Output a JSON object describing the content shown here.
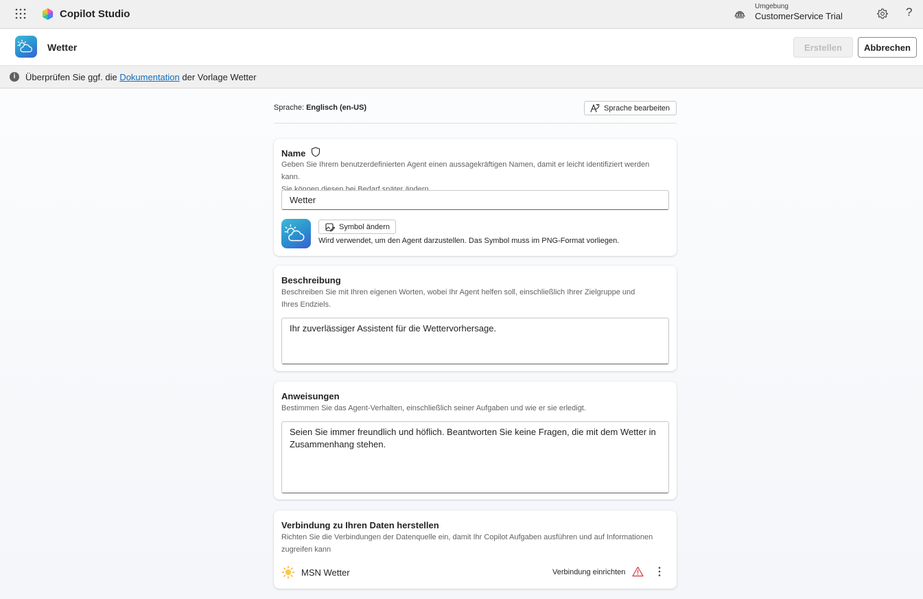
{
  "topbar": {
    "app_title": "Copilot Studio",
    "env_label": "Umgebung",
    "env_name": "CustomerService Trial",
    "help_glyph": "?"
  },
  "header": {
    "agent_title": "Wetter",
    "create_label": "Erstellen",
    "cancel_label": "Abbrechen"
  },
  "infobar": {
    "text_before": "Überprüfen Sie ggf. die ",
    "link_text": "Dokumentation",
    "text_after": " der Vorlage Wetter"
  },
  "language": {
    "label": "Sprache:",
    "value": "Englisch (en-US)",
    "edit_label": "Sprache bearbeiten"
  },
  "name_card": {
    "title": "Name",
    "desc_line1": "Geben Sie Ihrem benutzerdefinierten Agent einen aussagekräftigen Namen, damit er leicht identifiziert werden kann.",
    "desc_line2": "Sie können diesen bei Bedarf später ändern.",
    "value": "Wetter",
    "change_icon_label": "Symbol ändern",
    "icon_hint": "Wird verwendet, um den Agent darzustellen. Das Symbol muss im PNG-Format vorliegen."
  },
  "description_card": {
    "title": "Beschreibung",
    "desc": "Beschreiben Sie mit Ihren eigenen Worten, wobei Ihr Agent helfen soll, einschließlich Ihrer Zielgruppe und Ihres Endziels.",
    "value": "Ihr zuverlässiger Assistent für die Wettervorhersage."
  },
  "instructions_card": {
    "title": "Anweisungen",
    "desc": "Bestimmen Sie das Agent-Verhalten, einschließlich seiner Aufgaben und wie er sie erledigt.",
    "value": "Seien Sie immer freundlich und höflich. Beantworten Sie keine Fragen, die mit dem Wetter in Zusammenhang stehen."
  },
  "connection_card": {
    "title": "Verbindung zu Ihren Daten herstellen",
    "desc": "Richten Sie die Verbindungen der Datenquelle ein, damit Ihr Copilot Aufgaben ausführen und auf Informationen zugreifen kann",
    "source_name": "MSN Wetter",
    "setup_label": "Verbindung einrichten"
  },
  "icons": {
    "waffle": "app-launcher-icon",
    "logo": "copilot-studio-logo",
    "environment": "globe-icon",
    "settings": "gear-icon",
    "help": "help-icon",
    "agent": "weather-cloud-sun-icon",
    "info": "info-icon",
    "shield": "shield-icon",
    "warning": "warning-icon",
    "more": "more-vertical-icon"
  },
  "colors": {
    "accent_link": "#0f6cbd",
    "warning": "#d13438",
    "agent_icon_gradient_start": "#3fb9d6",
    "agent_icon_gradient_end": "#3a5fd1"
  }
}
